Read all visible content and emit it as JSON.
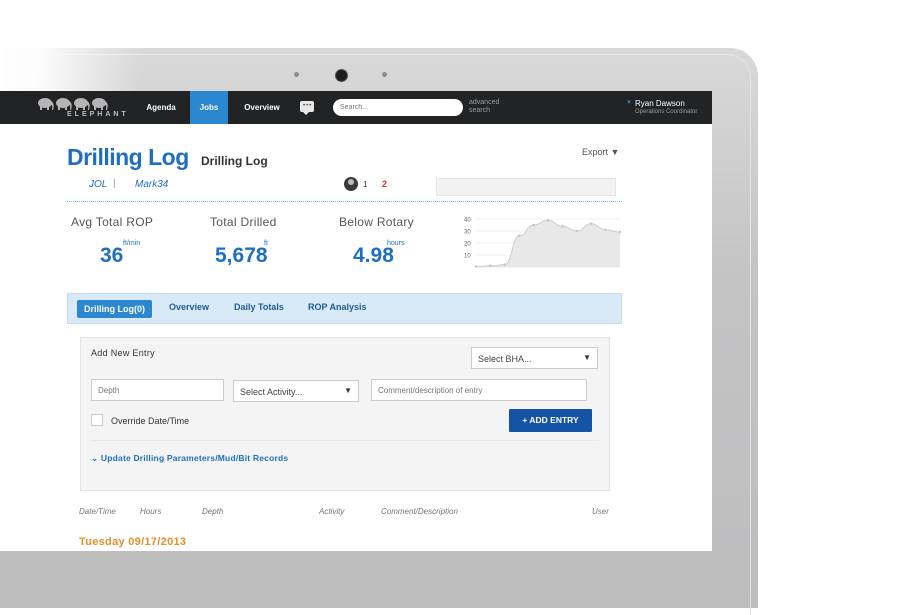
{
  "nav": {
    "logo_text": "ELEPHANT",
    "items": [
      "Agenda",
      "Jobs",
      "Overview"
    ],
    "search_placeholder": "Search...",
    "advanced_search": [
      "advanced",
      "search"
    ],
    "user_name": "Ryan Dawson",
    "user_role": "Operations Coordinator"
  },
  "header": {
    "title": "Drilling Log",
    "subtitle": "Drilling Log",
    "export_label": "Export",
    "crumbs": [
      "JOL",
      "|",
      "Mark34"
    ],
    "count_people": "1",
    "count_alert": "2"
  },
  "stats": [
    {
      "label": "Avg Total ROP",
      "value": "36",
      "unit": "ft/min"
    },
    {
      "label": "Total Drilled",
      "value": "5,678",
      "unit": "ft"
    },
    {
      "label": "Below Rotary",
      "value": "4.98",
      "unit": "hours"
    }
  ],
  "chart_data": {
    "type": "area",
    "y_ticks": [
      "40",
      "30",
      "20",
      "10"
    ],
    "ylim": [
      0,
      40
    ],
    "x": [
      0,
      1,
      2,
      3,
      4,
      5,
      6,
      7,
      8,
      9,
      10
    ],
    "values": [
      0.5,
      1,
      2,
      26,
      35,
      39,
      34,
      30,
      36,
      31,
      29
    ],
    "grid": true
  },
  "tabs": [
    "Drilling Log(0)",
    "Overview",
    "Daily Totals",
    "ROP Analysis"
  ],
  "form": {
    "title": "Add New Entry",
    "bha_select": "Select BHA...",
    "depth_placeholder": "Depth",
    "activity_select": "Select Activity...",
    "comment_placeholder": "Comment/description of entry",
    "override_label": "Override Date/Time",
    "add_button": "+ ADD ENTRY",
    "update_link": "Update Drilling Parameters/Mud/Bit Records"
  },
  "table": {
    "columns": [
      "Date/Time",
      "Hours",
      "Depth",
      "Activity",
      "Comment/Description",
      "User"
    ],
    "group_date": "Tuesday 09/17/2013"
  },
  "colors": {
    "accent": "#1f6fbf",
    "nav_bg": "#222325",
    "active_tab": "#2a87d0",
    "alert": "#e0342a",
    "date": "#e0922a"
  }
}
